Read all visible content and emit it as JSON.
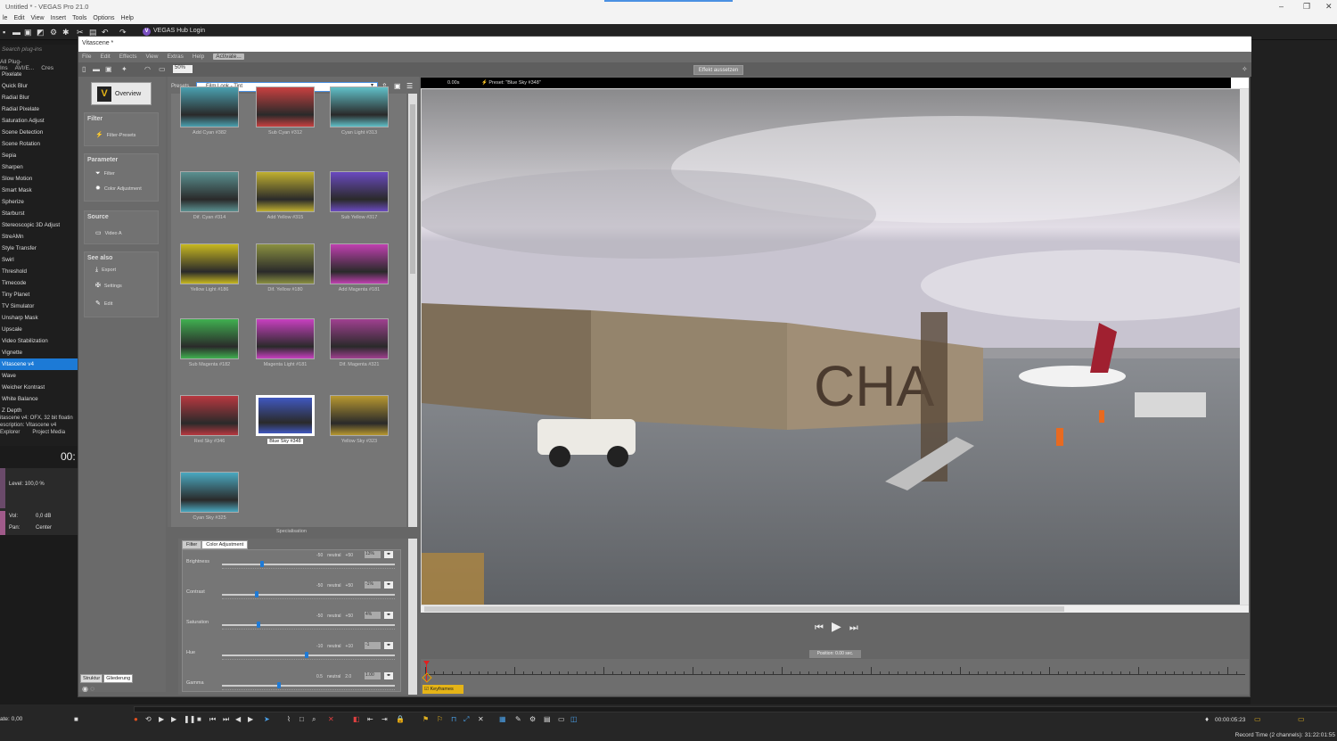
{
  "host": {
    "title": "Untitled * - VEGAS Pro 21.0",
    "menu": [
      "le",
      "Edit",
      "View",
      "Insert",
      "Tools",
      "Options",
      "Help"
    ],
    "hub_label": "VEGAS Hub Login",
    "window_controls": [
      "–",
      "❐",
      "✕"
    ]
  },
  "plugins": {
    "search_placeholder": "Search plug-ins",
    "tabs": [
      "All Plug-Ins",
      "AVI/E...",
      "Cres"
    ],
    "items": [
      "Pixelate",
      "Quick Blur",
      "Radial Blur",
      "Radial Pixelate",
      "Saturation Adjust",
      "Scene Detection",
      "Scene Rotation",
      "Sepia",
      "Sharpen",
      "Slow Motion",
      "Smart Mask",
      "Spherize",
      "Starburst",
      "Stereoscopic 3D Adjust",
      "StreAMn",
      "Style Transfer",
      "Swirl",
      "Threshold",
      "Timecode",
      "Tiny Planet",
      "TV Simulator",
      "Unsharp Mask",
      "Upscale",
      "Video Stabilization",
      "Vignette",
      "Vitascene v4",
      "Wave",
      "Weicher Kontrast",
      "White Balance",
      "Z Depth"
    ],
    "selected": "Vitascene v4",
    "info_line1": "itascene v4: OFX, 32 bit floatin",
    "info_line2": "escription: Vitascene v4",
    "explorer_tabs": [
      "Explorer",
      "Project Media"
    ]
  },
  "audio": {
    "timecode": "00:",
    "level": "Level: 100,0 %",
    "vol_label": "Vol:",
    "vol_value": "0,0 dB",
    "pan_label": "Pan:",
    "pan_value": "Center"
  },
  "vitascene": {
    "title": "Vitascene *",
    "menu": [
      "File",
      "Edit",
      "Effects",
      "View",
      "Extras",
      "Help"
    ],
    "activate": "Activate...",
    "zoom": "50%",
    "effect_button": "Effekt aussetzen",
    "overview": "Overview",
    "sections": {
      "filter": "Filter",
      "filter_presets": "Filter-Presets",
      "parameter": "Parameter",
      "param_filter": "Filter",
      "param_color": "Color Adjustment",
      "source": "Source",
      "video_a": "Video A",
      "see_also": "See also",
      "export": "Export",
      "settings": "Settings",
      "edit": "Edit"
    },
    "bottom_tabs": [
      "Struktur",
      "Gliederung"
    ],
    "presets_label": "Presets",
    "preset_selected": "Film Look - Tint",
    "presets": [
      {
        "name": "Add Cyan #382",
        "tint": "#4aa0b0"
      },
      {
        "name": "Sub Cyan #312",
        "tint": "#c84040"
      },
      {
        "name": "Cyan Light #313",
        "tint": "#60c0c8"
      },
      {
        "name": "Dif. Cyan #314",
        "tint": "#5a9090"
      },
      {
        "name": "Add Yellow #315",
        "tint": "#c0b030"
      },
      {
        "name": "Sub Yellow #317",
        "tint": "#6a4ac0"
      },
      {
        "name": "Yellow Light #186",
        "tint": "#c8b820"
      },
      {
        "name": "Dif. Yellow #180",
        "tint": "#8a9040"
      },
      {
        "name": "Add Magenta #181",
        "tint": "#c040b0"
      },
      {
        "name": "Sub Magenta #182",
        "tint": "#40b050"
      },
      {
        "name": "Magenta Light #181",
        "tint": "#c840c0"
      },
      {
        "name": "Dif. Magenta #321",
        "tint": "#a04090"
      },
      {
        "name": "Red Sky #346",
        "tint": "#b83840"
      },
      {
        "name": "Blue Sky #348",
        "tint": "#4058c0"
      },
      {
        "name": "Yellow Sky #323",
        "tint": "#b89830"
      },
      {
        "name": "Cyan Sky #325",
        "tint": "#4aa8c0"
      }
    ],
    "selected_preset": "Blue Sky #348",
    "specialisation": "Specialisation",
    "param_tabs": [
      "Filter",
      "Color Adjustment"
    ],
    "params": [
      {
        "name": "Brightness",
        "min": "-50",
        "mid": "neutral",
        "max": "+50",
        "value": "13%",
        "pos": 0.23
      },
      {
        "name": "Contrast",
        "min": "-50",
        "mid": "neutral",
        "max": "+50",
        "value": "-1%",
        "pos": 0.2
      },
      {
        "name": "Saturation",
        "min": "-50",
        "mid": "neutral",
        "max": "+50",
        "value": "4%",
        "pos": 0.21
      },
      {
        "name": "Hue",
        "min": "-10",
        "mid": "neutral",
        "max": "+10",
        "value": "-1",
        "pos": 0.49
      },
      {
        "name": "Gamma",
        "min": "0.5",
        "mid": "neutral",
        "max": "2.0",
        "value": "1.00",
        "pos": 0.33
      }
    ],
    "preview": {
      "time": "0.00s",
      "preset_text": "Preset: \"Blue Sky #348\"",
      "sign_text": "CHA"
    },
    "position": "Position: 0.00 sec.",
    "keyframes": "Keyframes"
  },
  "transport": {
    "rate": "ate: 0,00",
    "timecode": "00:00:05:23",
    "record_time": "Record Time (2 channels): 31:22:01:55"
  }
}
